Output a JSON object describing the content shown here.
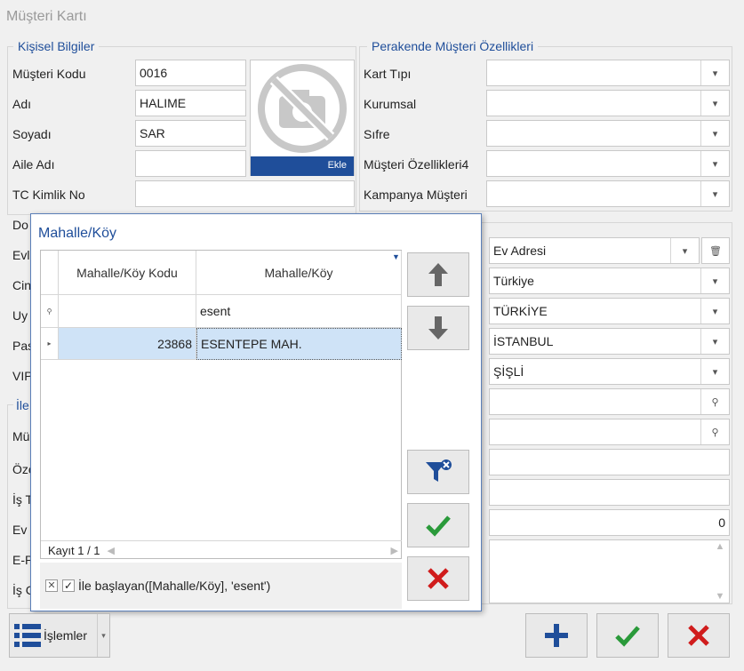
{
  "window": {
    "title": "Müşteri Kartı"
  },
  "personal": {
    "title": "Kişisel Bilgiler",
    "customer_code_label": "Müşteri Kodu",
    "customer_code": "0016",
    "name_label": "Adı",
    "name": "HALIME",
    "surname_label": "Soyadı",
    "surname": "SAR",
    "family_name_label": "Aile Adı",
    "family_name": "",
    "tc_label": "TC Kimlik No",
    "tc": "",
    "photo_add": "Ekle"
  },
  "partial_labels": {
    "do": "Do",
    "ev": "Evl",
    "ci": "Cin",
    "uy": "Uy",
    "pa": "Pas",
    "vi": "VIP",
    "ile": "İle",
    "mu": "Mü",
    "oz": "Öze",
    "is": "İş T",
    "ev2": "Ev",
    "ep": "E-P",
    "isc": "İş C"
  },
  "retail": {
    "title": "Perakende Müşteri Özellikleri",
    "card_type_label": "Kart Tıpı",
    "corporate_label": "Kurumsal",
    "password_label": "Sıfre",
    "features4_label": "Müşteri Özellikleri4",
    "campaign_label": "Kampanya Müşteri"
  },
  "address": {
    "address_type": "Ev Adresi",
    "country": "Türkiye",
    "country_upper": "TÜRKİYE",
    "city": "İSTANBUL",
    "district": "ŞİŞLİ",
    "number_value": "0"
  },
  "dialog": {
    "title": "Mahalle/Köy",
    "col_code": "Mahalle/Köy Kodu",
    "col_name": "Mahalle/Köy",
    "filter_value": "esent",
    "rows": [
      {
        "code": "23868",
        "name": "ESENTEPE MAH."
      }
    ],
    "record_info": "Kayıt 1 / 1",
    "filter_text": "İle başlayan([Mahalle/Köy], 'esent')"
  },
  "footer": {
    "actions_label": "İşlemler"
  },
  "colors": {
    "accent": "#1f4e9a",
    "confirm": "#2a9a3a",
    "cancel": "#d01c1c"
  }
}
